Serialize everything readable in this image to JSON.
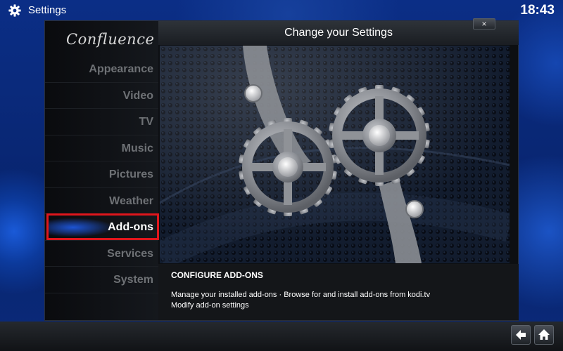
{
  "topbar": {
    "title": "Settings",
    "icon": "gear-icon",
    "clock": "18:43"
  },
  "sidebar": {
    "logo": "Confluence",
    "items": [
      {
        "label": "Appearance",
        "active": false
      },
      {
        "label": "Video",
        "active": false
      },
      {
        "label": "TV",
        "active": false
      },
      {
        "label": "Music",
        "active": false
      },
      {
        "label": "Pictures",
        "active": false
      },
      {
        "label": "Weather",
        "active": false
      },
      {
        "label": "Add-ons",
        "active": true
      },
      {
        "label": "Services",
        "active": false
      },
      {
        "label": "System",
        "active": false
      }
    ]
  },
  "header": {
    "title": "Change your Settings",
    "close_label": "×"
  },
  "info": {
    "title": "CONFIGURE ADD-ONS",
    "line1": "Manage your installed add-ons · Browse for and install add-ons from kodi.tv",
    "line2": "Modify add-on settings"
  },
  "bottom": {
    "back_icon": "back-arrow-icon",
    "home_icon": "home-icon"
  },
  "colors": {
    "highlight": "#e0161c",
    "accent": "#1d54d4"
  }
}
